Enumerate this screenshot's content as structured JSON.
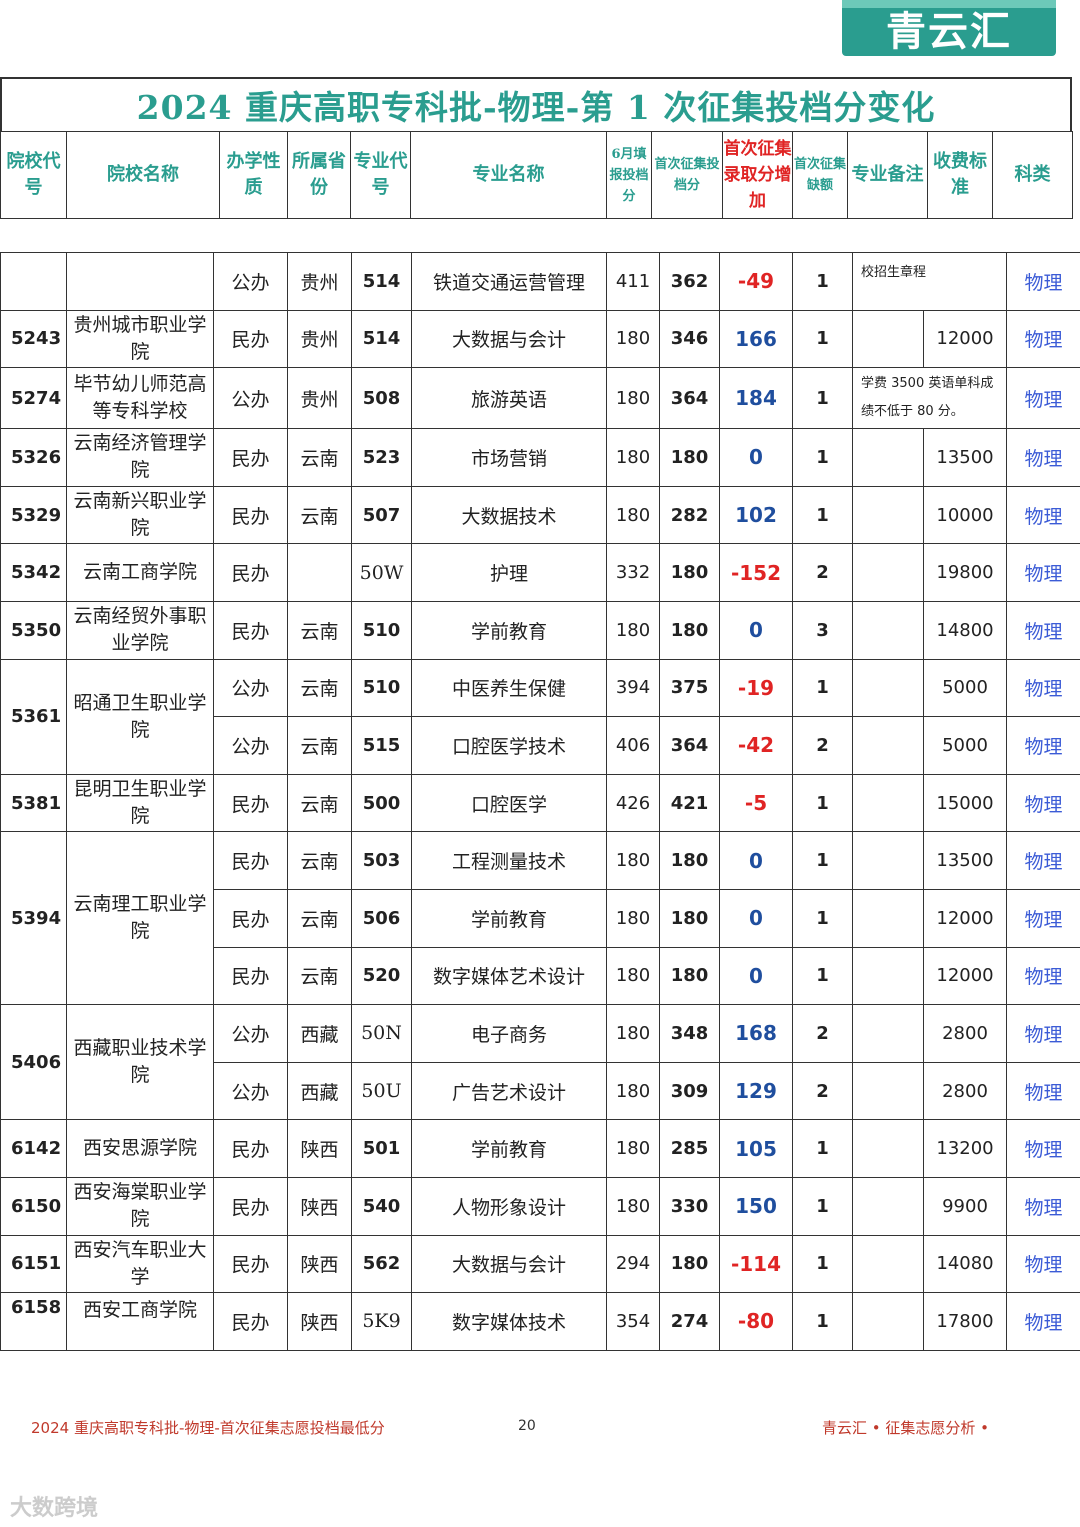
{
  "logo": {
    "text": "青云汇"
  },
  "title": "2024 重庆高职专科批-物理-第 1 次征集投档分变化",
  "headers": {
    "school_code": "院校代号",
    "school_name": "院校名称",
    "ownership": "办学性质",
    "province": "所属省份",
    "major_code": "专业代号",
    "major_name": "专业名称",
    "june_score": "6月填报投档分",
    "first_score": "首次征集投档分",
    "increase": "首次征集录取分增加",
    "vacancy": "首次征集缺额",
    "remark": "专业备注",
    "fee": "收费标准",
    "category": "科类"
  },
  "rows": [
    {
      "code": "",
      "name": "",
      "own": "公办",
      "prov": "贵州",
      "mcode": "514",
      "major": "铁道交通运营管理",
      "june": "411",
      "first": "362",
      "delta": "-49",
      "vac": "1",
      "remark": "校招生章程",
      "fee": "",
      "cat": "物理"
    },
    {
      "code": "5243",
      "name": "贵州城市职业学院",
      "own": "民办",
      "prov": "贵州",
      "mcode": "514",
      "major": "大数据与会计",
      "june": "180",
      "first": "346",
      "delta": "166",
      "vac": "1",
      "remark": "",
      "fee": "12000",
      "cat": "物理"
    },
    {
      "code": "5274",
      "name": "毕节幼儿师范高等专科学校",
      "own": "公办",
      "prov": "贵州",
      "mcode": "508",
      "major": "旅游英语",
      "june": "180",
      "first": "364",
      "delta": "184",
      "vac": "1",
      "remark": "学费 3500 英语单科成绩不低于 80 分。",
      "fee": "",
      "cat": "物理"
    },
    {
      "code": "5326",
      "name": "云南经济管理学院",
      "own": "民办",
      "prov": "云南",
      "mcode": "523",
      "major": "市场营销",
      "june": "180",
      "first": "180",
      "delta": "0",
      "vac": "1",
      "remark": "",
      "fee": "13500",
      "cat": "物理"
    },
    {
      "code": "5329",
      "name": "云南新兴职业学院",
      "own": "民办",
      "prov": "云南",
      "mcode": "507",
      "major": "大数据技术",
      "june": "180",
      "first": "282",
      "delta": "102",
      "vac": "1",
      "remark": "",
      "fee": "10000",
      "cat": "物理"
    },
    {
      "code": "5342",
      "name": "云南工商学院",
      "own": "民办",
      "prov": "",
      "mcode": "50W",
      "major": "护理",
      "june": "332",
      "first": "180",
      "delta": "-152",
      "vac": "2",
      "remark": "",
      "fee": "19800",
      "cat": "物理"
    },
    {
      "code": "5350",
      "name": "云南经贸外事职业学院",
      "own": "民办",
      "prov": "云南",
      "mcode": "510",
      "major": "学前教育",
      "june": "180",
      "first": "180",
      "delta": "0",
      "vac": "3",
      "remark": "",
      "fee": "14800",
      "cat": "物理"
    },
    {
      "code": "5361",
      "name": "昭通卫生职业学院",
      "own": "公办",
      "prov": "云南",
      "mcode": "510",
      "major": "中医养生保健",
      "june": "394",
      "first": "375",
      "delta": "-19",
      "vac": "1",
      "remark": "",
      "fee": "5000",
      "cat": "物理"
    },
    {
      "code": "",
      "name": "",
      "own": "公办",
      "prov": "云南",
      "mcode": "515",
      "major": "口腔医学技术",
      "june": "406",
      "first": "364",
      "delta": "-42",
      "vac": "2",
      "remark": "",
      "fee": "5000",
      "cat": "物理"
    },
    {
      "code": "5381",
      "name": "昆明卫生职业学院",
      "own": "民办",
      "prov": "云南",
      "mcode": "500",
      "major": "口腔医学",
      "june": "426",
      "first": "421",
      "delta": "-5",
      "vac": "1",
      "remark": "",
      "fee": "15000",
      "cat": "物理"
    },
    {
      "code": "5394",
      "name": "云南理工职业学院",
      "own": "民办",
      "prov": "云南",
      "mcode": "503",
      "major": "工程测量技术",
      "june": "180",
      "first": "180",
      "delta": "0",
      "vac": "1",
      "remark": "",
      "fee": "13500",
      "cat": "物理"
    },
    {
      "code": "",
      "name": "",
      "own": "民办",
      "prov": "云南",
      "mcode": "506",
      "major": "学前教育",
      "june": "180",
      "first": "180",
      "delta": "0",
      "vac": "1",
      "remark": "",
      "fee": "12000",
      "cat": "物理"
    },
    {
      "code": "",
      "name": "",
      "own": "民办",
      "prov": "云南",
      "mcode": "520",
      "major": "数字媒体艺术设计",
      "june": "180",
      "first": "180",
      "delta": "0",
      "vac": "1",
      "remark": "",
      "fee": "12000",
      "cat": "物理"
    },
    {
      "code": "5406",
      "name": "西藏职业技术学院",
      "own": "公办",
      "prov": "西藏",
      "mcode": "50N",
      "major": "电子商务",
      "june": "180",
      "first": "348",
      "delta": "168",
      "vac": "2",
      "remark": "",
      "fee": "2800",
      "cat": "物理"
    },
    {
      "code": "",
      "name": "",
      "own": "公办",
      "prov": "西藏",
      "mcode": "50U",
      "major": "广告艺术设计",
      "june": "180",
      "first": "309",
      "delta": "129",
      "vac": "2",
      "remark": "",
      "fee": "2800",
      "cat": "物理"
    },
    {
      "code": "6142",
      "name": "西安思源学院",
      "own": "民办",
      "prov": "陕西",
      "mcode": "501",
      "major": "学前教育",
      "june": "180",
      "first": "285",
      "delta": "105",
      "vac": "1",
      "remark": "",
      "fee": "13200",
      "cat": "物理"
    },
    {
      "code": "6150",
      "name": "西安海棠职业学院",
      "own": "民办",
      "prov": "陕西",
      "mcode": "540",
      "major": "人物形象设计",
      "june": "180",
      "first": "330",
      "delta": "150",
      "vac": "1",
      "remark": "",
      "fee": "9900",
      "cat": "物理"
    },
    {
      "code": "6151",
      "name": "西安汽车职业大学",
      "own": "民办",
      "prov": "陕西",
      "mcode": "562",
      "major": "大数据与会计",
      "june": "294",
      "first": "180",
      "delta": "-114",
      "vac": "1",
      "remark": "",
      "fee": "14080",
      "cat": "物理"
    },
    {
      "code": "6158",
      "name": "西安工商学院",
      "own": "民办",
      "prov": "陕西",
      "mcode": "5K9",
      "major": "数字媒体技术",
      "june": "354",
      "first": "274",
      "delta": "-80",
      "vac": "1",
      "remark": "",
      "fee": "17800",
      "cat": "物理"
    }
  ],
  "footer": {
    "left": "2024 重庆高职专科批-物理-首次征集志愿投档最低分",
    "page": "20",
    "right": "青云汇 • 征集志愿分析 •"
  },
  "watermark": "大数跨境"
}
